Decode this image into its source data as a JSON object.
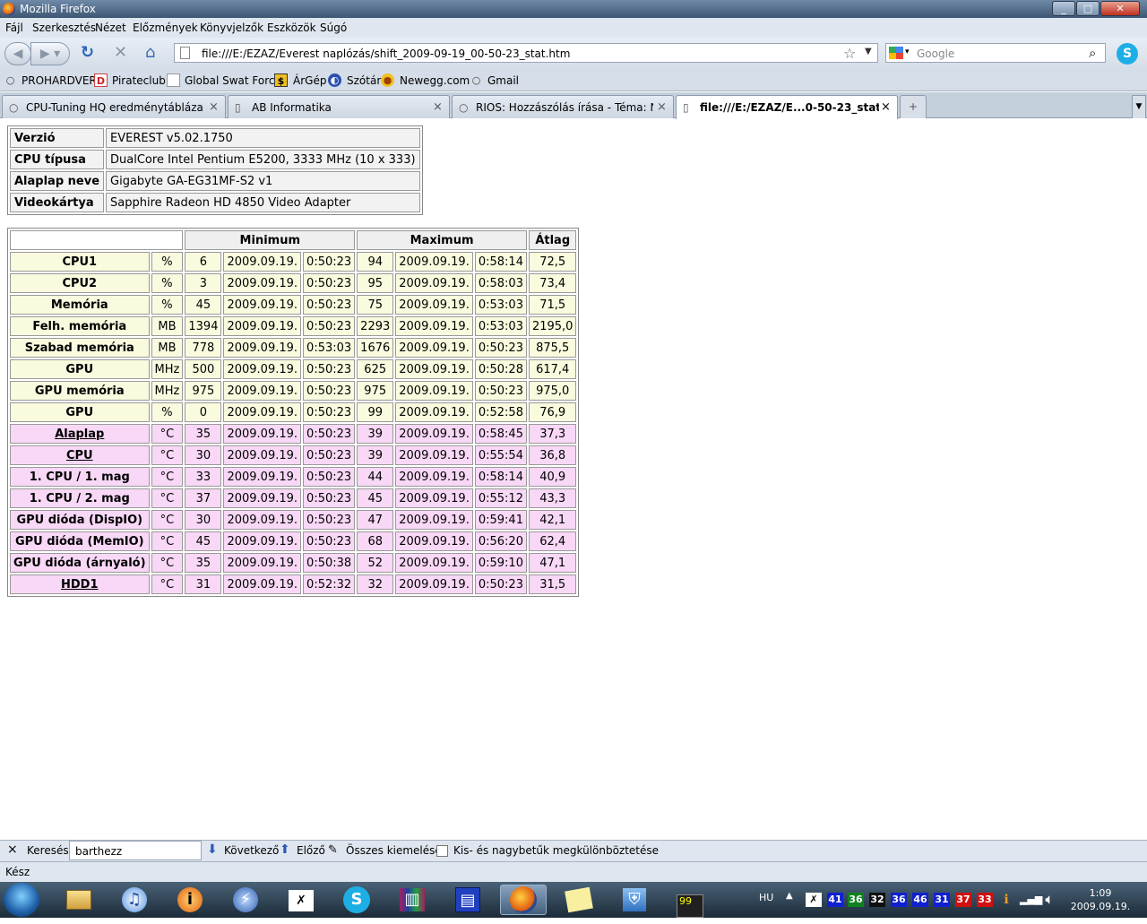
{
  "window": {
    "title": "Mozilla Firefox",
    "min": "_",
    "max": "□",
    "close": "✕"
  },
  "menu": [
    "Fájl",
    "Szerkesztés",
    "Nézet",
    "Előzmények",
    "Könyvjelzők",
    "Eszközök",
    "Súgó"
  ],
  "nav": {
    "url": "file:///E:/EZAZ/Everest naplózás/shift_2009-09-19_00-50-23_stat.htm",
    "search_placeholder": "Google"
  },
  "bookmarks": [
    "PROHARDVER",
    "Pirateclub",
    "Global Swat Force",
    "ÁrGép",
    "Szótár",
    "Newegg.com",
    "Gmail"
  ],
  "tabs": [
    {
      "title": "CPU-Tuning HQ eredménytáblázat ..."
    },
    {
      "title": "AB Informatika"
    },
    {
      "title": "RIOS: Hozzászólás írása - Téma: Nee..."
    },
    {
      "title": "file:///E:/EZAZ/E...0-50-23_stat.htm"
    }
  ],
  "info": [
    {
      "k": "Verzió",
      "v": "EVEREST v5.02.1750"
    },
    {
      "k": "CPU típusa",
      "v": "DualCore Intel Pentium E5200, 3333 MHz (10 x 333)"
    },
    {
      "k": "Alaplap neve",
      "v": "Gigabyte GA-EG31MF-S2 v1"
    },
    {
      "k": "Videokártya",
      "v": "Sapphire Radeon HD 4850 Video Adapter"
    }
  ],
  "stats_header": {
    "min": "Minimum",
    "max": "Maximum",
    "avg": "Átlag"
  },
  "stats": [
    {
      "name": "CPU1",
      "unit": "%",
      "min": "6",
      "min_date": "2009.09.19.",
      "min_time": "0:50:23",
      "max": "94",
      "max_date": "2009.09.19.",
      "max_time": "0:58:14",
      "avg": "72,5",
      "type": "y",
      "link": false
    },
    {
      "name": "CPU2",
      "unit": "%",
      "min": "3",
      "min_date": "2009.09.19.",
      "min_time": "0:50:23",
      "max": "95",
      "max_date": "2009.09.19.",
      "max_time": "0:58:03",
      "avg": "73,4",
      "type": "y",
      "link": false
    },
    {
      "name": "Memória",
      "unit": "%",
      "min": "45",
      "min_date": "2009.09.19.",
      "min_time": "0:50:23",
      "max": "75",
      "max_date": "2009.09.19.",
      "max_time": "0:53:03",
      "avg": "71,5",
      "type": "y",
      "link": false
    },
    {
      "name": "Felh. memória",
      "unit": "MB",
      "min": "1394",
      "min_date": "2009.09.19.",
      "min_time": "0:50:23",
      "max": "2293",
      "max_date": "2009.09.19.",
      "max_time": "0:53:03",
      "avg": "2195,0",
      "type": "y",
      "link": false
    },
    {
      "name": "Szabad memória",
      "unit": "MB",
      "min": "778",
      "min_date": "2009.09.19.",
      "min_time": "0:53:03",
      "max": "1676",
      "max_date": "2009.09.19.",
      "max_time": "0:50:23",
      "avg": "875,5",
      "type": "y",
      "link": false
    },
    {
      "name": "GPU",
      "unit": "MHz",
      "min": "500",
      "min_date": "2009.09.19.",
      "min_time": "0:50:23",
      "max": "625",
      "max_date": "2009.09.19.",
      "max_time": "0:50:28",
      "avg": "617,4",
      "type": "y",
      "link": false
    },
    {
      "name": "GPU memória",
      "unit": "MHz",
      "min": "975",
      "min_date": "2009.09.19.",
      "min_time": "0:50:23",
      "max": "975",
      "max_date": "2009.09.19.",
      "max_time": "0:50:23",
      "avg": "975,0",
      "type": "y",
      "link": false
    },
    {
      "name": "GPU",
      "unit": "%",
      "min": "0",
      "min_date": "2009.09.19.",
      "min_time": "0:50:23",
      "max": "99",
      "max_date": "2009.09.19.",
      "max_time": "0:52:58",
      "avg": "76,9",
      "type": "y",
      "link": false
    },
    {
      "name": "Alaplap",
      "unit": "°C",
      "min": "35",
      "min_date": "2009.09.19.",
      "min_time": "0:50:23",
      "max": "39",
      "max_date": "2009.09.19.",
      "max_time": "0:58:45",
      "avg": "37,3",
      "type": "p",
      "link": true
    },
    {
      "name": "CPU",
      "unit": "°C",
      "min": "30",
      "min_date": "2009.09.19.",
      "min_time": "0:50:23",
      "max": "39",
      "max_date": "2009.09.19.",
      "max_time": "0:55:54",
      "avg": "36,8",
      "type": "p",
      "link": true
    },
    {
      "name": "1. CPU / 1. mag",
      "unit": "°C",
      "min": "33",
      "min_date": "2009.09.19.",
      "min_time": "0:50:23",
      "max": "44",
      "max_date": "2009.09.19.",
      "max_time": "0:58:14",
      "avg": "40,9",
      "type": "p",
      "link": false
    },
    {
      "name": "1. CPU / 2. mag",
      "unit": "°C",
      "min": "37",
      "min_date": "2009.09.19.",
      "min_time": "0:50:23",
      "max": "45",
      "max_date": "2009.09.19.",
      "max_time": "0:55:12",
      "avg": "43,3",
      "type": "p",
      "link": false
    },
    {
      "name": "GPU dióda (DispIO)",
      "unit": "°C",
      "min": "30",
      "min_date": "2009.09.19.",
      "min_time": "0:50:23",
      "max": "47",
      "max_date": "2009.09.19.",
      "max_time": "0:59:41",
      "avg": "42,1",
      "type": "p",
      "link": false
    },
    {
      "name": "GPU dióda (MemIO)",
      "unit": "°C",
      "min": "45",
      "min_date": "2009.09.19.",
      "min_time": "0:50:23",
      "max": "68",
      "max_date": "2009.09.19.",
      "max_time": "0:56:20",
      "avg": "62,4",
      "type": "p",
      "link": false
    },
    {
      "name": "GPU dióda (árnyaló)",
      "unit": "°C",
      "min": "35",
      "min_date": "2009.09.19.",
      "min_time": "0:50:38",
      "max": "52",
      "max_date": "2009.09.19.",
      "max_time": "0:59:10",
      "avg": "47,1",
      "type": "p",
      "link": false
    },
    {
      "name": "HDD1",
      "unit": "°C",
      "min": "31",
      "min_date": "2009.09.19.",
      "min_time": "0:52:32",
      "max": "32",
      "max_date": "2009.09.19.",
      "max_time": "0:50:23",
      "avg": "31,5",
      "type": "p",
      "link": true
    }
  ],
  "findbar": {
    "close": "×",
    "label": "Keresés:",
    "value": "barthezz",
    "next": "Következő",
    "prev": "Előző",
    "highlight": "Összes kiemelése",
    "match_case": "Kis- és nagybetűk megkülönböztetése"
  },
  "status": "Kész",
  "taskbar": {
    "lang": "HU",
    "tray_values": [
      {
        "v": "41",
        "bg": "#1020d0"
      },
      {
        "v": "36",
        "bg": "#108020"
      },
      {
        "v": "32",
        "bg": "#101010"
      },
      {
        "v": "36",
        "bg": "#1020d0"
      },
      {
        "v": "46",
        "bg": "#1020d0"
      },
      {
        "v": "31",
        "bg": "#1020d0"
      },
      {
        "v": "37",
        "bg": "#d01010"
      },
      {
        "v": "33",
        "bg": "#d01010"
      }
    ],
    "time": "1:09",
    "date": "2009.09.19."
  },
  "colors": {
    "row_load": "#fafade",
    "row_temp": "#f8d8f6"
  }
}
